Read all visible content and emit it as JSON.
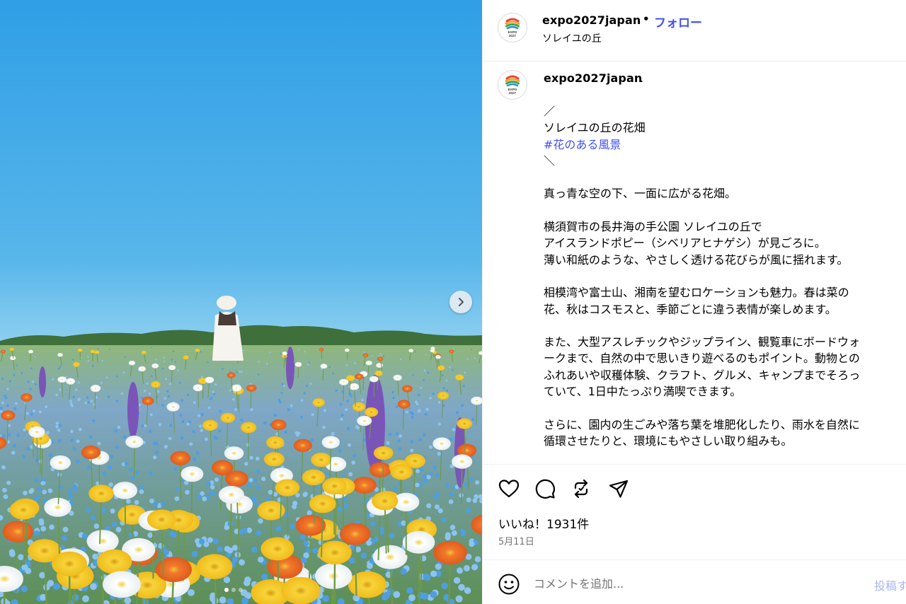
{
  "post": {
    "username": "expo2027japan",
    "separator": "•",
    "follow_label": "フォロー",
    "location": "ソレイユの丘",
    "avatar_text": [
      "EXPO",
      "2027"
    ]
  },
  "caption": {
    "username": "expo2027japan",
    "username_suffix": ".",
    "lines": [
      "／",
      "ソレイユの丘の花畑",
      "#花のある風景",
      "＼",
      "",
      "真っ青な空の下、一面に広がる花畑。",
      "",
      "横須賀市の長井海の手公園 ソレイユの丘で",
      "アイスランドポピー（シベリアヒナゲシ）が見ごろに。",
      "薄い和紙のような、やさしく透ける花びらが風に揺れます。",
      "",
      "相模湾や富士山、湘南を望むロケーションも魅力。春は菜の",
      "花、秋はコスモスと、季節ごとに違う表情が楽しめます。",
      "",
      "また、大型アスレチックやジップライン、観覧車にボードウォ",
      "ークまで、自然の中で思いきり遊べるのもポイント。動物との",
      "ふれあいや収穫体験、クラフト、グルメ、キャンプまでそろっ",
      "ていて、1日中たっぷり満喫できます。",
      "",
      "さらに、園内の生ごみや落ち葉を堆肥化したり、雨水を自然に",
      "循環させたりと、環境にもやさしい取り組みも。"
    ],
    "hashtag_line_index": 2
  },
  "engagement": {
    "likes_text": "いいね！1931件",
    "date_text": "5月11日"
  },
  "comment": {
    "placeholder": "コメントを追加...",
    "post_label": "投稿す"
  },
  "media": {
    "slide_count": 3,
    "active_slide": 1,
    "sky_color_top": "#2f9fe6",
    "sky_color_bottom": "#7cc8ee"
  },
  "colors": {
    "accent": "#4150f7",
    "muted": "#737373",
    "post_disabled": "#a8b6f5"
  },
  "icons": [
    "chevron-right-icon",
    "heart-icon",
    "comment-icon",
    "repost-icon",
    "share-icon",
    "emoji-icon"
  ]
}
